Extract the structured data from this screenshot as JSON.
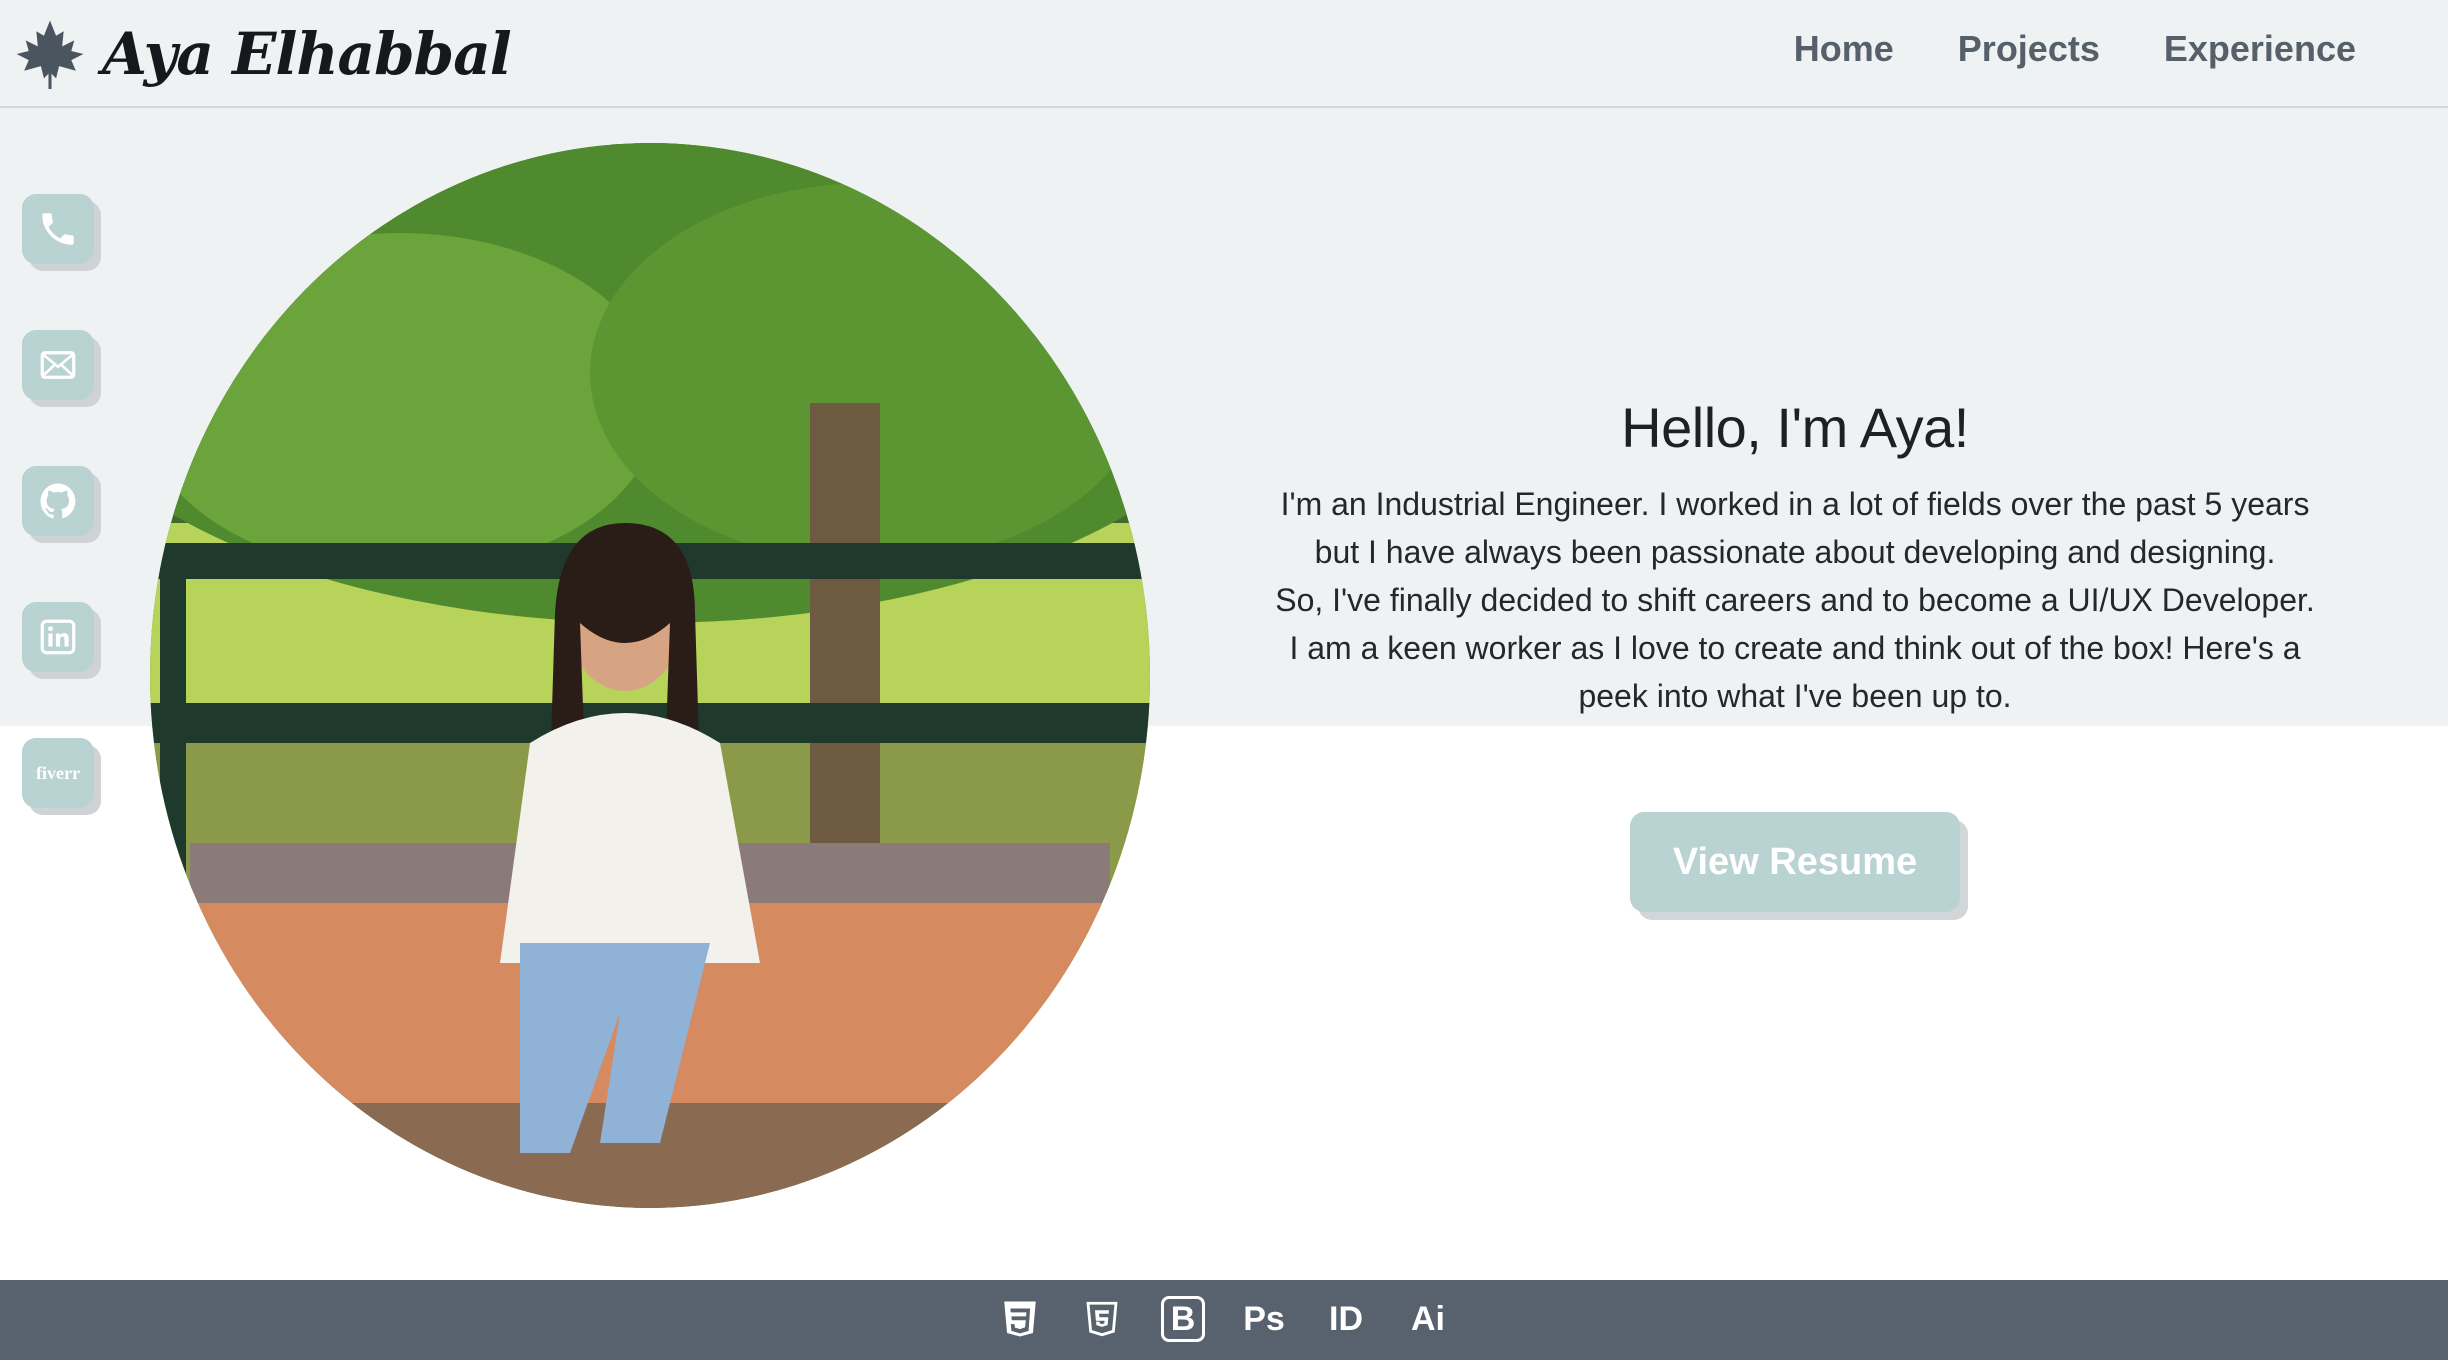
{
  "brand": {
    "name": "Aya Elhabbal",
    "logo_icon": "maple-leaf-icon"
  },
  "nav": {
    "items": [
      {
        "label": "Home"
      },
      {
        "label": "Projects"
      },
      {
        "label": "Experience"
      }
    ]
  },
  "social": [
    {
      "icon": "phone-icon"
    },
    {
      "icon": "mail-icon"
    },
    {
      "icon": "github-icon"
    },
    {
      "icon": "linkedin-icon"
    },
    {
      "icon": "fiverr-icon",
      "label": "fiverr"
    }
  ],
  "intro": {
    "title": "Hello, I'm Aya!",
    "lines": [
      "I'm an Industrial Engineer. I worked in a lot of fields over the past 5 years",
      "but I have always been passionate about developing and designing.",
      "So, I've finally decided to shift careers and to become a UI/UX Developer.",
      "I am a keen worker as I love to create and think out of the box! Here's a",
      "peek into what I've been up to."
    ]
  },
  "resume_button": {
    "label": "View Resume"
  },
  "footer": {
    "tech_icons": [
      {
        "name": "css3-icon"
      },
      {
        "name": "html5-icon"
      },
      {
        "name": "bootstrap-icon",
        "label": "B"
      },
      {
        "name": "photoshop-icon",
        "label": "Ps"
      },
      {
        "name": "indesign-icon",
        "label": "ID"
      },
      {
        "name": "illustrator-icon",
        "label": "Ai"
      }
    ]
  },
  "colors": {
    "accent": "#b9d2d2",
    "background_top": "#eff2f3",
    "footer": "#58626e",
    "nav_text": "#56606b"
  }
}
